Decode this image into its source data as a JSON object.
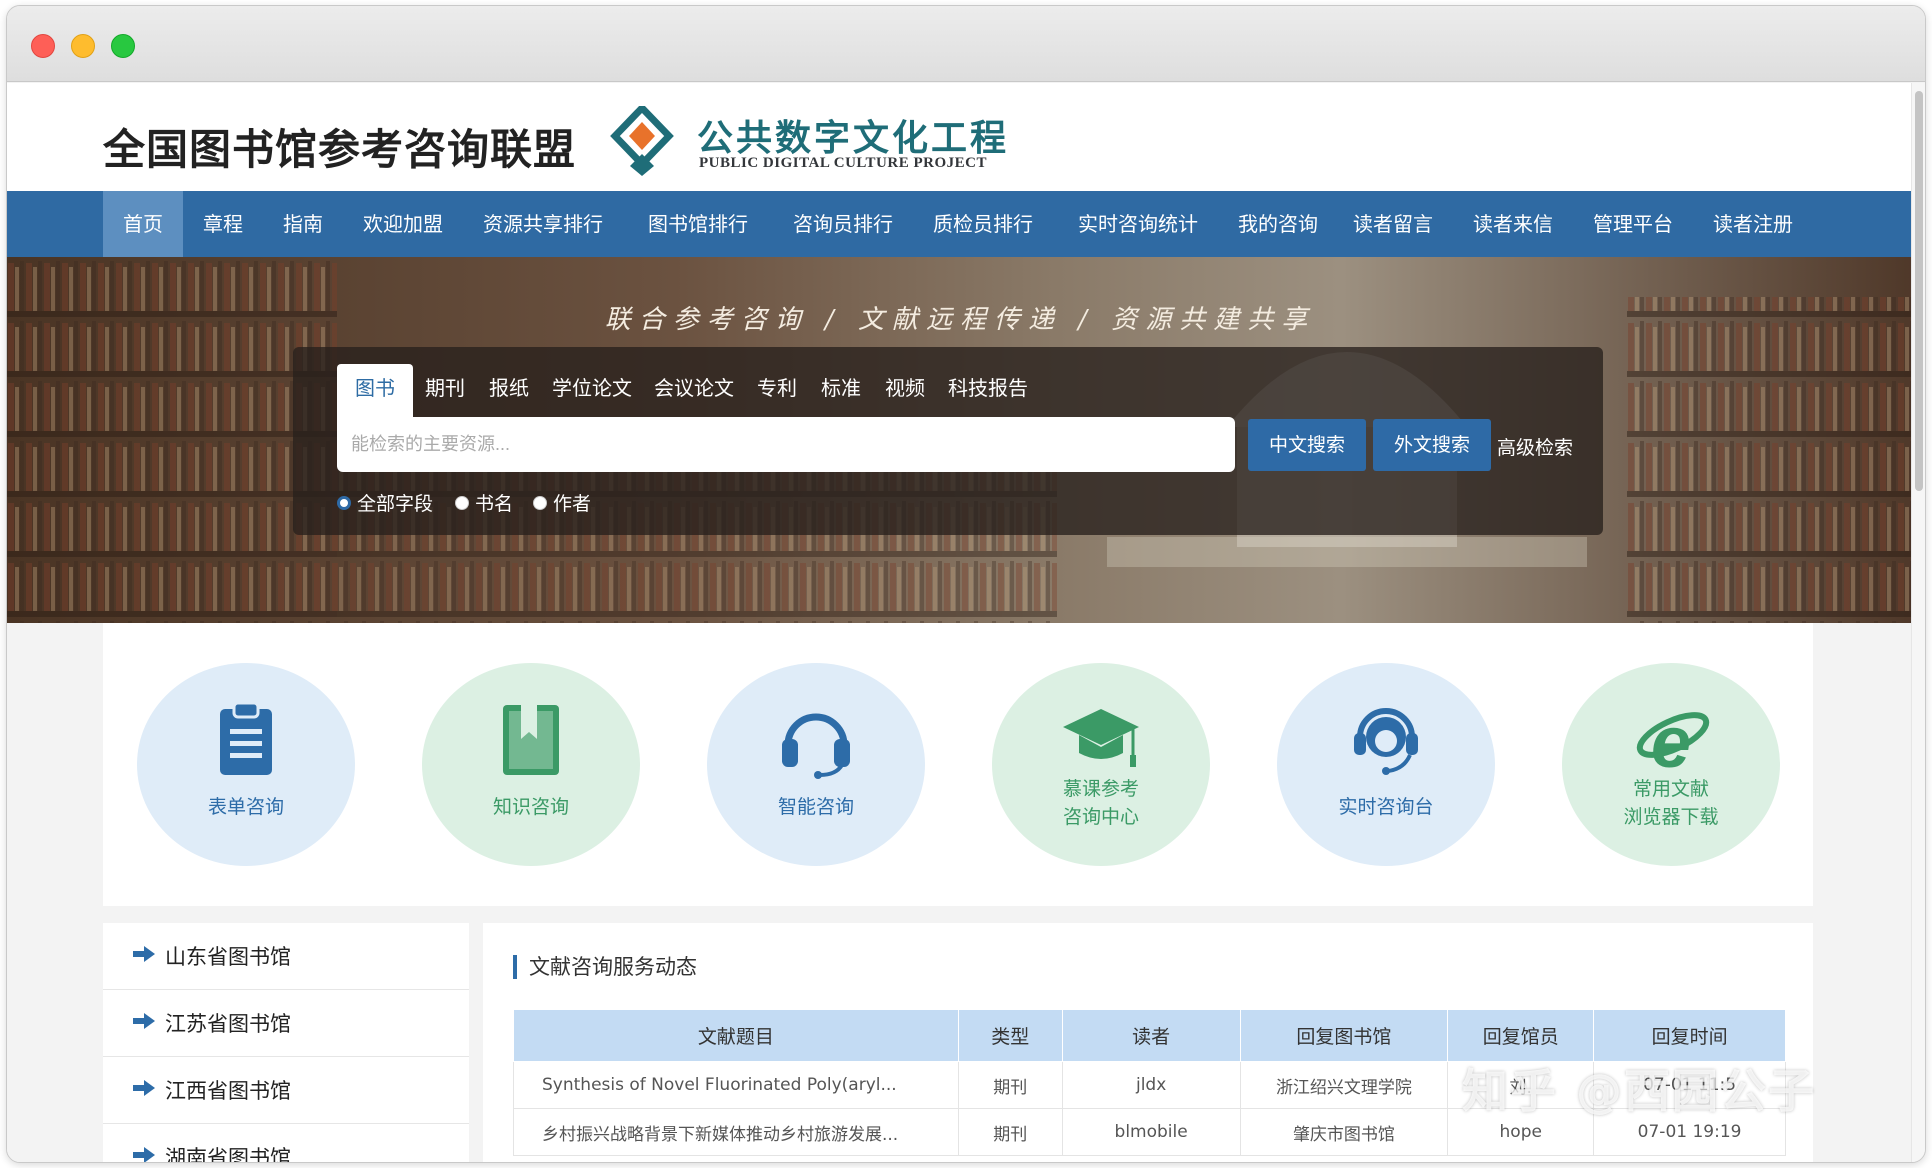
{
  "header": {
    "site_title": "全国图书馆参考咨询联盟",
    "logo_cn": "公共数字文化工程",
    "logo_en": "PUBLIC DIGITAL CULTURE PROJECT"
  },
  "nav": {
    "items": [
      "首页",
      "章程",
      "指南",
      "欢迎加盟",
      "资源共享排行",
      "图书馆排行",
      "咨询员排行",
      "质检员排行",
      "实时咨询统计",
      "我的咨询",
      "读者留言",
      "读者来信",
      "管理平台",
      "读者注册"
    ],
    "active": "首页"
  },
  "banner": {
    "slogan": "联合参考咨询 / 文献远程传递 / 资源共建共享"
  },
  "search": {
    "tabs": [
      "图书",
      "期刊",
      "报纸",
      "学位论文",
      "会议论文",
      "专利",
      "标准",
      "视频",
      "科技报告"
    ],
    "active_tab": "图书",
    "placeholder": "能检索的主要资源...",
    "value": "",
    "chinese_search": "中文搜索",
    "foreign_search": "外文搜索",
    "advanced": "高级检索",
    "fields": [
      "全部字段",
      "书名",
      "作者"
    ],
    "selected_field": "全部字段"
  },
  "services": [
    {
      "line1": "表单咨询",
      "line2": "",
      "icon": "clipboard-icon",
      "color": "blue"
    },
    {
      "line1": "知识咨询",
      "line2": "",
      "icon": "book-icon",
      "color": "green"
    },
    {
      "line1": "智能咨询",
      "line2": "",
      "icon": "headphones-icon",
      "color": "blue"
    },
    {
      "line1": "慕课参考",
      "line2": "咨询中心",
      "icon": "graduation-cap-icon",
      "color": "green"
    },
    {
      "line1": "实时咨询台",
      "line2": "",
      "icon": "customer-service-icon",
      "color": "blue"
    },
    {
      "line1": "常用文献",
      "line2": "浏览器下载",
      "icon": "ie-browser-icon",
      "color": "green"
    }
  ],
  "libraries": [
    "山东省图书馆",
    "江苏省图书馆",
    "江西省图书馆",
    "湖南省图书馆"
  ],
  "news": {
    "title": "文献咨询服务动态",
    "columns": [
      "文献题目",
      "类型",
      "读者",
      "回复图书馆",
      "回复馆员",
      "回复时间"
    ],
    "rows": [
      [
        "Synthesis of Novel Fluorinated Poly(aryl...",
        "期刊",
        "jldx",
        "浙江绍兴文理学院",
        "刘.",
        "07-01 11:5"
      ],
      [
        "乡村振兴战略背景下新媒体推动乡村旅游发展...",
        "期刊",
        "blmobile",
        "肇庆市图书馆",
        "hope",
        "07-01 19:19"
      ]
    ]
  },
  "watermark": "知乎 @西园公子",
  "colors": {
    "nav": "#2f6aa3",
    "accent": "#2d6ca8",
    "green": "#3b9a66"
  }
}
